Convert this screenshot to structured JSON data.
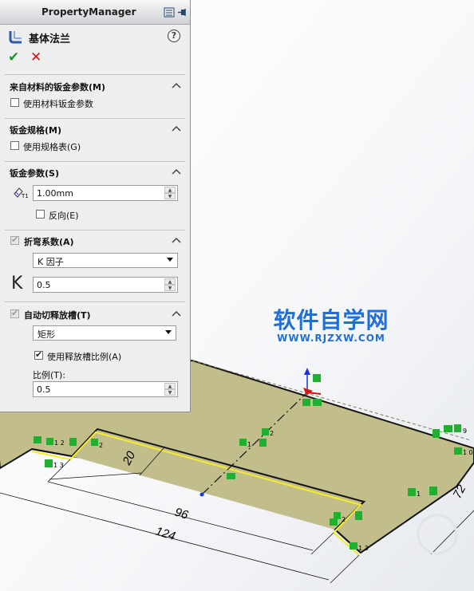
{
  "panel": {
    "title": "PropertyManager",
    "feature_name": "基体法兰",
    "help_symbol": "?",
    "ok_symbol": "✔",
    "cancel_symbol": "✕",
    "sections": {
      "material": {
        "title": "来自材料的钣金参数(M)",
        "checkbox_label": "使用材料钣金参数",
        "checked": false
      },
      "gauge": {
        "title": "钣金规格(M)",
        "checkbox_label": "使用规格表(G)",
        "checked": false
      },
      "params": {
        "title": "钣金参数(S)",
        "thickness_value": "1.00mm",
        "reverse_label": "反向(E)",
        "reverse_checked": false
      },
      "bend": {
        "title": "折弯系数(A)",
        "checked": true,
        "type_value": "K 因子",
        "k_symbol": "K",
        "k_value": "0.5"
      },
      "relief": {
        "title": "自动切释放槽(T)",
        "checked": true,
        "type_value": "矩形",
        "ratio_check_label": "使用释放槽比例(A)",
        "ratio_checked": true,
        "ratio_label": "比例(T):",
        "ratio_value": "0.5"
      }
    }
  },
  "watermark": {
    "title": "软件自学网",
    "url": "WWW.RJZXW.COM"
  },
  "drawing": {
    "dimensions": [
      "20",
      "96",
      "124",
      "72"
    ],
    "relation_tags": [
      "1 2",
      "2",
      "1 3",
      "1",
      "2",
      "1",
      "2",
      "1",
      "1 3",
      "9",
      "1 0"
    ],
    "colors": {
      "sheet_fill": "#c2be8c",
      "sheet_shadow": "#d9d6ad",
      "edge": "#141414",
      "edge_highlight": "#f5eb2d",
      "relation_badge": "#1fb02f",
      "axis_red": "#d91414",
      "axis_blue": "#1d34d8",
      "watermark_blue": "#1f6fd6",
      "annotation_red": "#e21b1b"
    }
  }
}
